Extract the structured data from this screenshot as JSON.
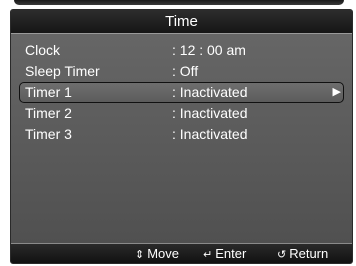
{
  "title": "Time",
  "menu": {
    "items": [
      {
        "label": "Clock",
        "value": ": 12 : 00  am",
        "selected": false
      },
      {
        "label": "Sleep Timer",
        "value": ": Off",
        "selected": false
      },
      {
        "label": "Timer 1",
        "value": ": Inactivated",
        "selected": true
      },
      {
        "label": "Timer 2",
        "value": ": Inactivated",
        "selected": false
      },
      {
        "label": "Timer 3",
        "value": ": Inactivated",
        "selected": false
      }
    ],
    "arrow": "▶"
  },
  "footer": {
    "move": {
      "icon": "updown-arrow-icon",
      "glyph": "⇕",
      "label": "Move"
    },
    "enter": {
      "icon": "enter-icon",
      "glyph": "↵",
      "label": "Enter"
    },
    "return": {
      "icon": "return-icon",
      "glyph": "↺",
      "label": "Return"
    }
  },
  "colors": {
    "panel": "#575757",
    "title_bar": "#1e1e1e",
    "text": "#ffffff",
    "selection_border": "#111111"
  }
}
